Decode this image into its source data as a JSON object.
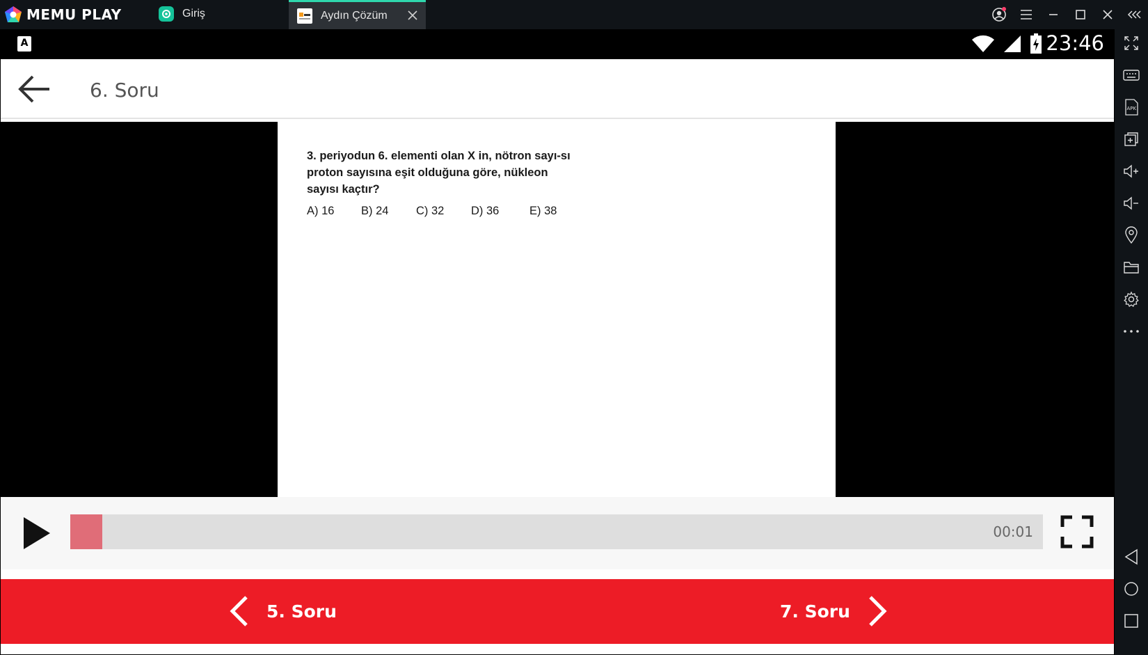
{
  "emulator": {
    "brand": "MEMU PLAY",
    "tabs": [
      {
        "label": "Giriş",
        "icon": "app-icon-giris"
      },
      {
        "label": "Aydın Çözüm",
        "icon": "app-icon-aydin",
        "active": true
      }
    ],
    "accent_color": "#2fd7ad"
  },
  "status_bar": {
    "keyboard_indicator": "A",
    "time": "23:46"
  },
  "app": {
    "title": "6. Soru",
    "question": {
      "text": "3. periyodun 6. elementi olan X in, nötron sayı-sı proton sayısına eşit olduğuna göre, nükleon sayısı kaçtır?",
      "options": [
        "A) 16",
        "B) 24",
        "C) 32",
        "D) 36",
        "E) 38"
      ]
    },
    "player": {
      "current_time": "00:01",
      "progress_fraction": 0.033
    },
    "navigation": {
      "prev_label": "5. Soru",
      "next_label": "7. Soru",
      "color": "#ed1c26"
    }
  }
}
